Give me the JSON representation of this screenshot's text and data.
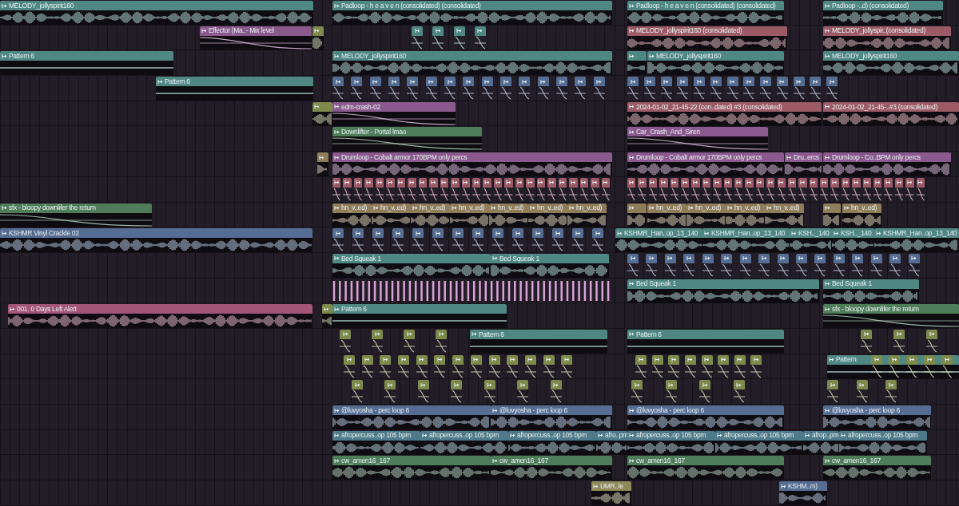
{
  "playlist": {
    "rows": [
      {
        "clips": [
          {
            "kind": "audio",
            "label": "MELODY_jollyspirit160",
            "color": "#4f8783"
          },
          {
            "kind": "audio",
            "label": "Padloop - h e a v e n (consolidated) (consolidated)",
            "color": "#4f8783"
          },
          {
            "kind": "audio",
            "label": "Padloop - h e a v e n (consolidated) (consolidated)",
            "color": "#4f8783"
          },
          {
            "kind": "audio",
            "label": "Padloop -..d) (consolidated)",
            "color": "#4f8783"
          }
        ]
      },
      {
        "clips": [
          {
            "kind": "automation",
            "label": "Effector (Ma..- Mix level",
            "color": "#8a5a8e"
          },
          {
            "kind": "block",
            "color": "#7d8a4c"
          },
          {
            "kind": "hits",
            "color": "#4f8783"
          },
          {
            "kind": "audio",
            "label": "MELODY_jollyspirit160 (consolidated)",
            "color": "#9b5a66"
          },
          {
            "kind": "audio",
            "label": "MELODY_jollyspir..(consolidated)",
            "color": "#9b5a66"
          }
        ]
      },
      {
        "clips": [
          {
            "kind": "pattern",
            "label": "Pattern 6",
            "color": "#4f8783"
          },
          {
            "kind": "audio",
            "label": "MELODY_jollyspirit160",
            "color": "#4f8783"
          },
          {
            "kind": "block",
            "color": "#4f8783"
          },
          {
            "kind": "audio",
            "label": "MELODY_jollyspirit160",
            "color": "#4f8783"
          },
          {
            "kind": "audio",
            "label": "MELODY_jollyspirit160",
            "color": "#4f8783"
          }
        ]
      },
      {
        "clips": [
          {
            "kind": "pattern",
            "label": "Pattern 6",
            "color": "#4f8783"
          },
          {
            "kind": "hits",
            "color": "#566d93"
          },
          {
            "kind": "hits",
            "color": "#566d93"
          }
        ]
      },
      {
        "clips": [
          {
            "kind": "block",
            "color": "#7d8a4c"
          },
          {
            "kind": "automation",
            "label": "edm-crash-02",
            "color": "#8a5a8e"
          },
          {
            "kind": "audio",
            "label": "2024-01-02_21-45-22 (con..dated) #3 (consolidated)",
            "color": "#9b5a66"
          },
          {
            "kind": "audio",
            "label": "2024-01-02_21-45-..#3 (consolidated)",
            "color": "#9b5a66"
          }
        ]
      },
      {
        "clips": [
          {
            "kind": "automation",
            "label": "Downlifter - Portal lmao",
            "color": "#4f7d5a"
          },
          {
            "kind": "automation",
            "label": "Car_Crash_And_Siren",
            "color": "#8a5a8e"
          }
        ]
      },
      {
        "clips": [
          {
            "kind": "block",
            "color": "#8f7d5a"
          },
          {
            "kind": "audio",
            "label": "Drumloop - Cobalt armor 170BPM only percs",
            "color": "#8a5a8e"
          },
          {
            "kind": "audio",
            "label": "Drumloop - Cobalt armor 170BPM only percs",
            "color": "#8a5a8e"
          },
          {
            "kind": "audio",
            "label": "Dru..ercs",
            "color": "#8a5a8e"
          },
          {
            "kind": "audio",
            "label": "Drumloop - Co..BPM only percs",
            "color": "#8a5a8e"
          }
        ]
      },
      {
        "clips": [
          {
            "kind": "hits",
            "color": "#9b5a66"
          },
          {
            "kind": "hits",
            "color": "#9b5a66"
          }
        ]
      },
      {
        "clips": [
          {
            "kind": "automation",
            "label": "sfx - bloopy downlifer the return",
            "color": "#4f7d5a"
          },
          {
            "kind": "audio",
            "label": "hn_v..ed)",
            "color": "#8f7d5a"
          },
          {
            "kind": "audio",
            "label": "hn_v..ed)",
            "color": "#8f7d5a"
          },
          {
            "kind": "audio",
            "label": "hn_v..ed)",
            "color": "#8f7d5a"
          },
          {
            "kind": "audio",
            "label": "hn_v..ed)",
            "color": "#8f7d5a"
          },
          {
            "kind": "audio",
            "label": "hn_v..ed)",
            "color": "#8f7d5a"
          },
          {
            "kind": "audio",
            "label": "hn_v..ed)",
            "color": "#8f7d5a"
          },
          {
            "kind": "audio",
            "label": "hn_v..ed)",
            "color": "#8f7d5a"
          },
          {
            "kind": "block",
            "color": "#8f7d5a"
          },
          {
            "kind": "audio",
            "label": "hn_v..ed)",
            "color": "#8f7d5a"
          },
          {
            "kind": "audio",
            "label": "hn_v..ed)",
            "color": "#8f7d5a"
          },
          {
            "kind": "audio",
            "label": "hn_v..ed)",
            "color": "#8f7d5a"
          },
          {
            "kind": "audio",
            "label": "hn_v..ed)",
            "color": "#8f7d5a"
          },
          {
            "kind": "block",
            "color": "#8f7d5a"
          },
          {
            "kind": "audio",
            "label": "hn_v..ed)",
            "color": "#8f7d5a"
          }
        ]
      },
      {
        "clips": [
          {
            "kind": "audio",
            "label": "KSHMR Vinyl Crackle 02",
            "color": "#566d93"
          },
          {
            "kind": "hits",
            "color": "#566d93"
          },
          {
            "kind": "audio",
            "label": "KSHMR_Han..op_13_140",
            "color": "#4f8783"
          },
          {
            "kind": "audio",
            "label": "KSHMR_Han..op_13_140",
            "color": "#4f8783"
          },
          {
            "kind": "audio",
            "label": "KSH.._140",
            "color": "#4f8783"
          },
          {
            "kind": "audio",
            "label": "KSH.._140",
            "color": "#4f8783"
          },
          {
            "kind": "audio",
            "label": "KSHMR_Han..op_13_140",
            "color": "#4f8783"
          }
        ]
      },
      {
        "clips": [
          {
            "kind": "audio",
            "label": "Bed Squeak 1",
            "color": "#4f8783"
          },
          {
            "kind": "audio",
            "label": "Bed Squeak 1",
            "color": "#4f8783"
          },
          {
            "kind": "hits",
            "color": "#566d93"
          }
        ]
      },
      {
        "clips": [
          {
            "kind": "ticks",
            "color": "#d9a3d6"
          },
          {
            "kind": "audio",
            "label": "Bed Squeak 1",
            "color": "#4f8783"
          },
          {
            "kind": "audio",
            "label": "Bed Squeak 1",
            "color": "#4f8783"
          }
        ]
      },
      {
        "clips": [
          {
            "kind": "audio",
            "label": "001. 0 Days Left Alert",
            "color": "#a25577"
          },
          {
            "kind": "block",
            "color": "#7d8a4c"
          },
          {
            "kind": "pattern",
            "label": "Pattern 6",
            "color": "#4f8783"
          },
          {
            "kind": "automation",
            "label": "sfx - bloopy downlifer the return",
            "color": "#4f7d5a"
          }
        ]
      },
      {
        "clips": [
          {
            "kind": "hits",
            "color": "#7d8a4c"
          },
          {
            "kind": "pattern",
            "label": "Pattern 6",
            "color": "#4f8783"
          },
          {
            "kind": "pattern",
            "label": "Pattern 6",
            "color": "#4f8783"
          },
          {
            "kind": "hits",
            "color": "#7d8a4c"
          }
        ]
      },
      {
        "clips": [
          {
            "kind": "hits",
            "color": "#7d8a4c"
          },
          {
            "kind": "hits",
            "color": "#7d8a4c"
          },
          {
            "kind": "pattern",
            "label": "Pattern",
            "color": "#4f8783"
          },
          {
            "kind": "hits",
            "color": "#7d8a4c"
          }
        ]
      },
      {
        "clips": [
          {
            "kind": "hits",
            "color": "#7d8a4c"
          },
          {
            "kind": "hits",
            "color": "#7d8a4c"
          },
          {
            "kind": "hits",
            "color": "#7d8a4c"
          }
        ]
      },
      {
        "clips": [
          {
            "kind": "audio",
            "label": "@luvyosha - perc loop 6",
            "color": "#566d93"
          },
          {
            "kind": "audio",
            "label": "@luvyosha - perc loop 6",
            "color": "#566d93"
          },
          {
            "kind": "audio",
            "label": "@luvyosha - perc loop 6",
            "color": "#566d93"
          },
          {
            "kind": "audio",
            "label": "@luvyosha - perc loop 6",
            "color": "#566d93"
          }
        ]
      },
      {
        "clips": [
          {
            "kind": "audio",
            "label": "afropercuss..op 105 bpm",
            "color": "#4f7a8a"
          },
          {
            "kind": "audio",
            "label": "afropercuss..op 105 bpm",
            "color": "#4f7a8a"
          },
          {
            "kind": "audio",
            "label": "afropercuss..op 105 bpm",
            "color": "#4f7a8a"
          },
          {
            "kind": "audio",
            "label": "afro..pm",
            "color": "#4f7a8a"
          },
          {
            "kind": "audio",
            "label": "afropercuss..op 105 bpm",
            "color": "#4f7a8a"
          },
          {
            "kind": "audio",
            "label": "afropercuss..op 105 bpm",
            "color": "#4f7a8a"
          },
          {
            "kind": "audio",
            "label": "afrop..pm",
            "color": "#4f7a8a"
          },
          {
            "kind": "audio",
            "label": "afropercuss..op 105 bpm",
            "color": "#4f7a8a"
          }
        ]
      },
      {
        "clips": [
          {
            "kind": "audio",
            "label": "cw_amen16_167",
            "color": "#4f7d5a"
          },
          {
            "kind": "audio",
            "label": "cw_amen16_167",
            "color": "#4f7d5a"
          },
          {
            "kind": "audio",
            "label": "cw_amen16_167",
            "color": "#4f7d5a"
          },
          {
            "kind": "audio",
            "label": "cw_amen16_167",
            "color": "#4f7d5a"
          }
        ]
      },
      {
        "clips": [
          {
            "kind": "audio",
            "label": "UMR..le",
            "color": "#8f8a5a"
          },
          {
            "kind": "audio",
            "label": "KSHM..m)",
            "color": "#566d93"
          }
        ]
      }
    ]
  }
}
